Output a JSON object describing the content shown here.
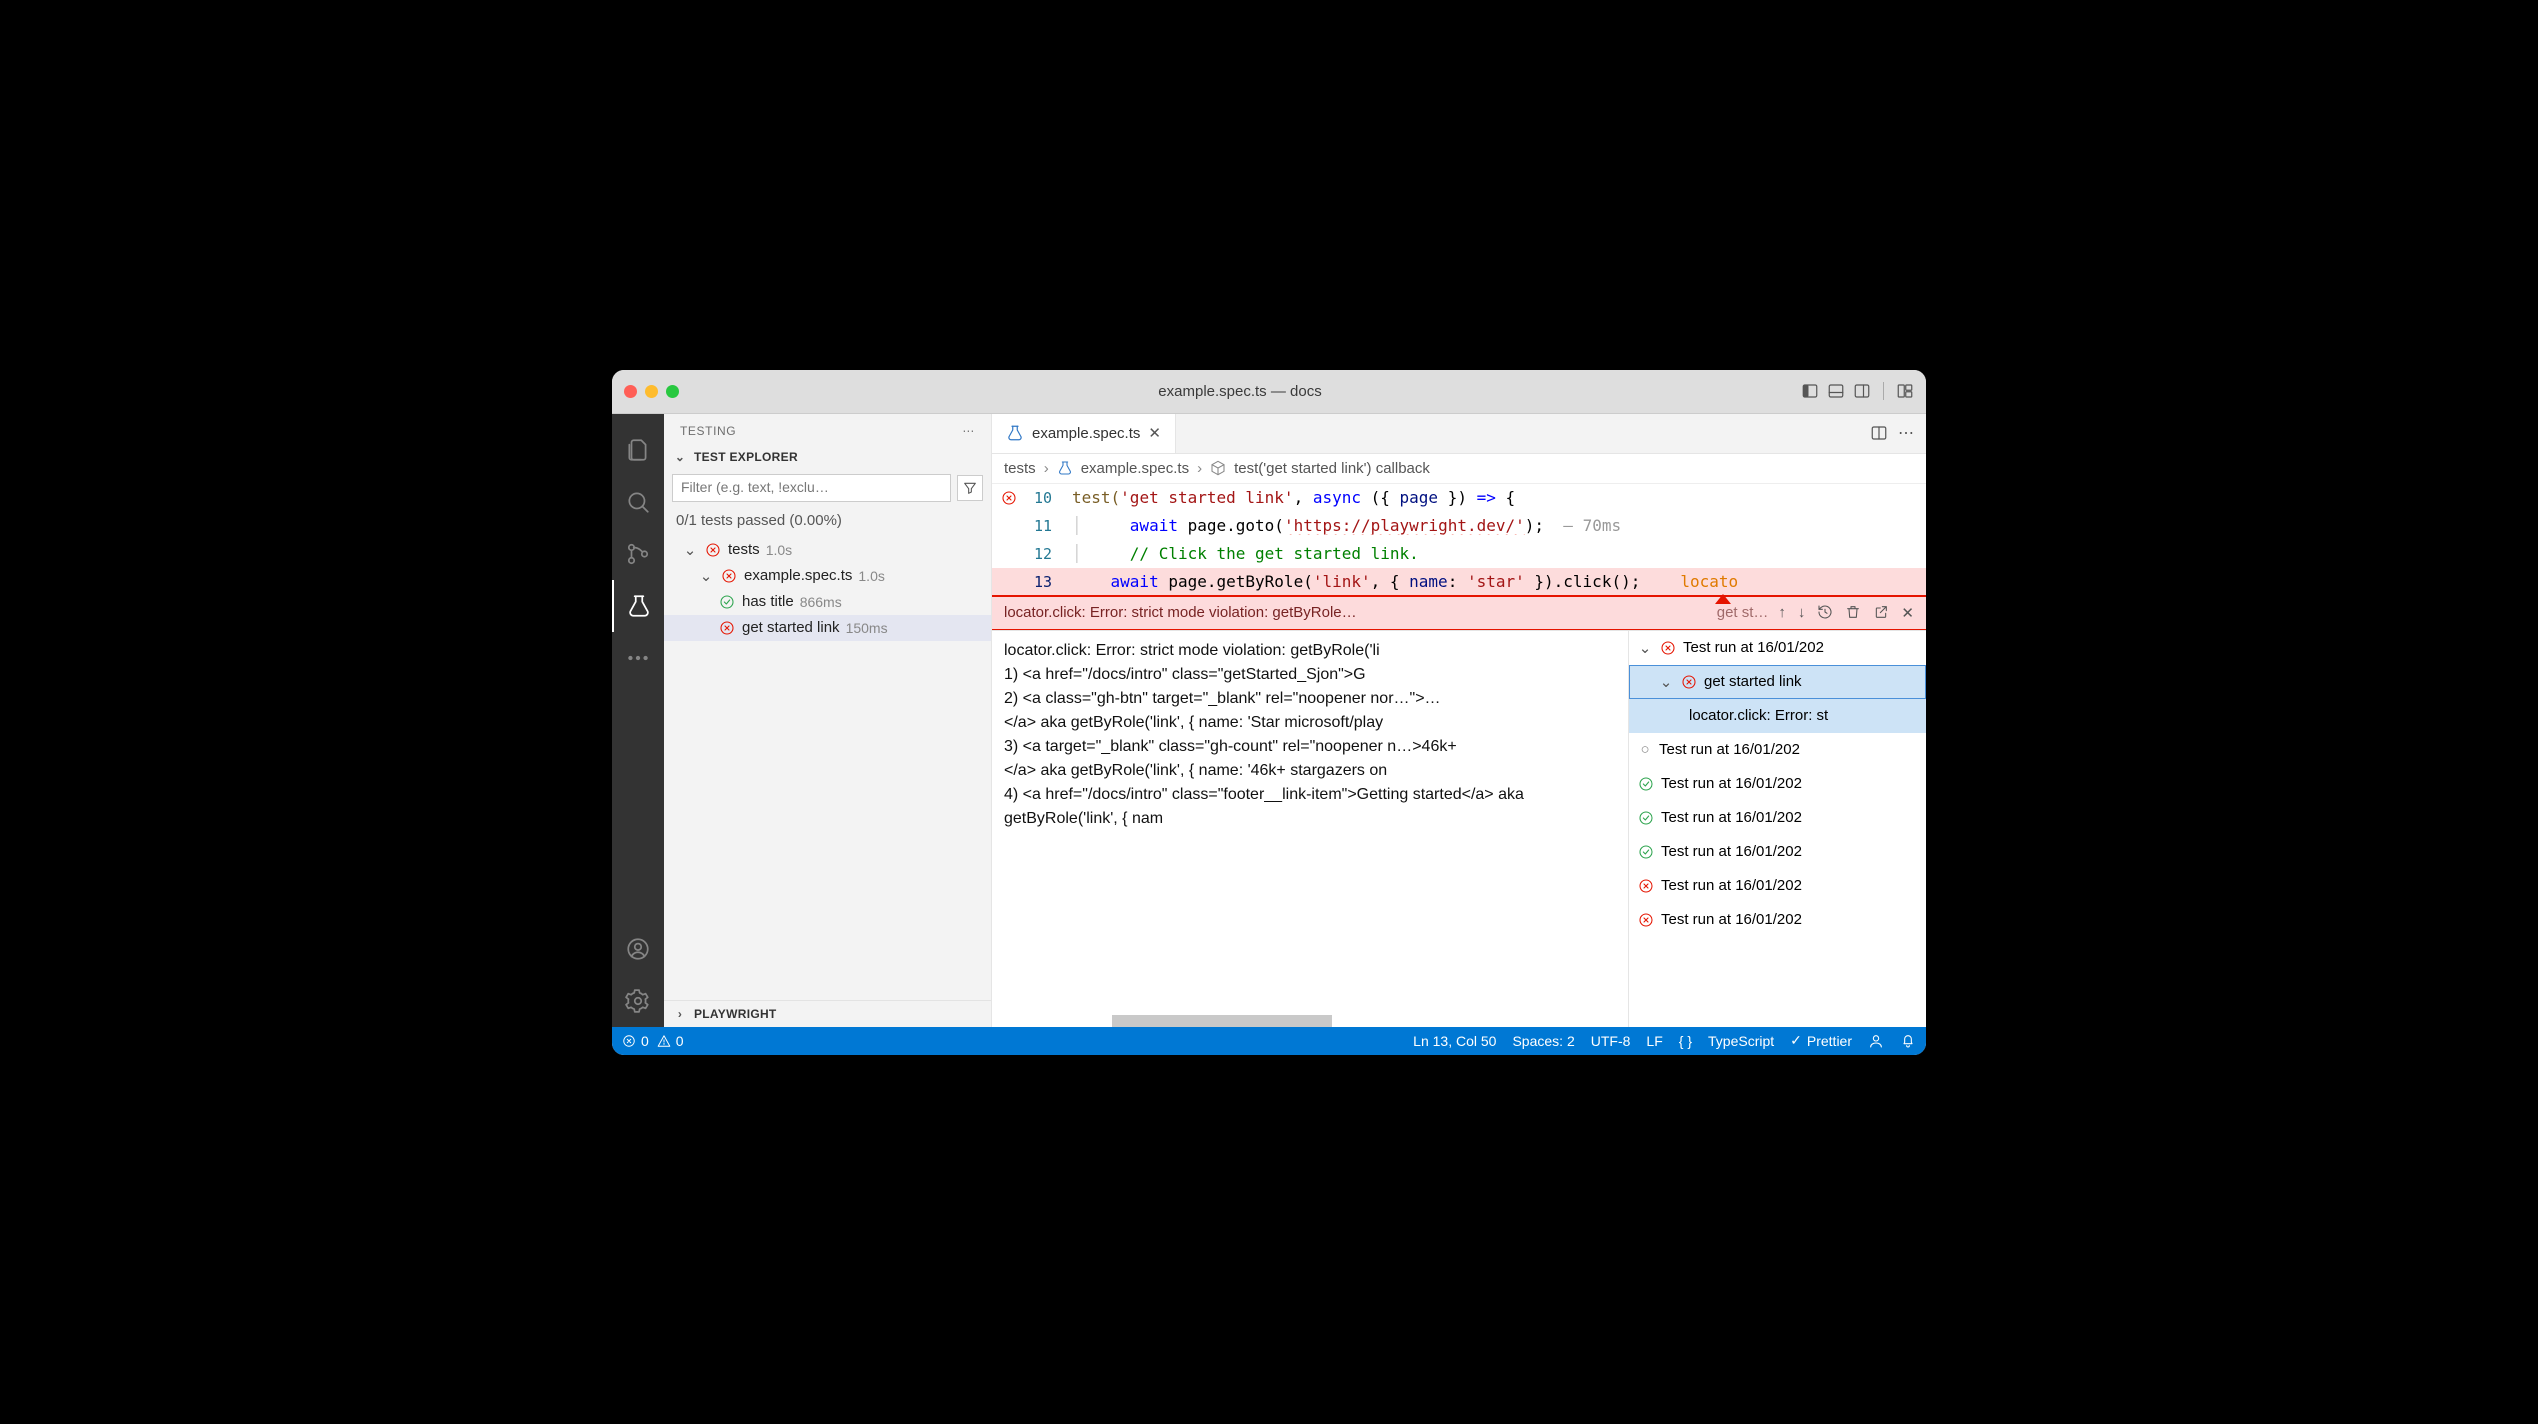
{
  "window": {
    "title": "example.spec.ts — docs"
  },
  "sidebar": {
    "header": "TESTING",
    "section": "TEST EXPLORER",
    "filter_placeholder": "Filter (e.g. text, !exclu…",
    "summary": "0/1 tests passed (0.00%)",
    "tree": {
      "root": {
        "label": "tests",
        "time": "1.0s"
      },
      "file": {
        "label": "example.spec.ts",
        "time": "1.0s"
      },
      "pass": {
        "label": "has title",
        "time": "866ms"
      },
      "fail": {
        "label": "get started link",
        "time": "150ms"
      }
    },
    "bottom_section": "PLAYWRIGHT"
  },
  "tab": {
    "name": "example.spec.ts"
  },
  "breadcrumb": {
    "p1": "tests",
    "p2": "example.spec.ts",
    "p3": "test('get started link') callback"
  },
  "code": {
    "l10": {
      "n": "10",
      "a": "test(",
      "b": "'get started link'",
      "c": ", ",
      "d": "async",
      "e": " ({ ",
      "f": "page",
      "g": " }) ",
      "h": "=>",
      "i": " {"
    },
    "l11": {
      "n": "11",
      "a": "    ",
      "b": "await",
      "c": " page.goto(",
      "d": "'https://playwright.dev/'",
      "e": ");  ",
      "f": "— 70ms"
    },
    "l12": {
      "n": "12",
      "a": "    ",
      "b": "// Click the get started link."
    },
    "l13": {
      "n": "13",
      "a": "    ",
      "b": "await",
      "c": " page.getByRole(",
      "d": "'link'",
      "e": ", { ",
      "f": "name",
      "g": ": ",
      "h": "'star'",
      "i": " }).click();",
      "hint": "locato"
    }
  },
  "problems": {
    "msg": "locator.click: Error: strict mode violation: getByRole…",
    "sub": "get st…"
  },
  "errdetail": {
    "l1": "locator.click: Error: strict mode violation: getByRole('li",
    "l2": "    1) <a href=\"/docs/intro\" class=\"getStarted_Sjon\">G",
    "l3": "    2) <a class=\"gh-btn\" target=\"_blank\" rel=\"noopener nor…\">…",
    "l4": "</a> aka getByRole('link', { name: 'Star microsoft/play",
    "l5": "    3) <a target=\"_blank\" class=\"gh-count\" rel=\"noopener n…>46k+",
    "l6": "</a> aka getByRole('link', { name: '46k+ stargazers on",
    "l7": "    4) <a href=\"/docs/intro\" class=\"footer__link-item\">Getting started</a> aka getByRole('link', { nam"
  },
  "runs": {
    "r0": "Test run at 16/01/202",
    "r1": "get started link",
    "r1b": "locator.click: Error: st",
    "r2": "Test run at 16/01/202",
    "r3": "Test run at 16/01/202",
    "r4": "Test run at 16/01/202",
    "r5": "Test run at 16/01/202",
    "r6": "Test run at 16/01/202",
    "r7": "Test run at 16/01/202"
  },
  "status": {
    "errors": "0",
    "warnings": "0",
    "pos": "Ln 13, Col 50",
    "spaces": "Spaces: 2",
    "enc": "UTF-8",
    "eol": "LF",
    "lang": "TypeScript",
    "fmt": "Prettier"
  }
}
